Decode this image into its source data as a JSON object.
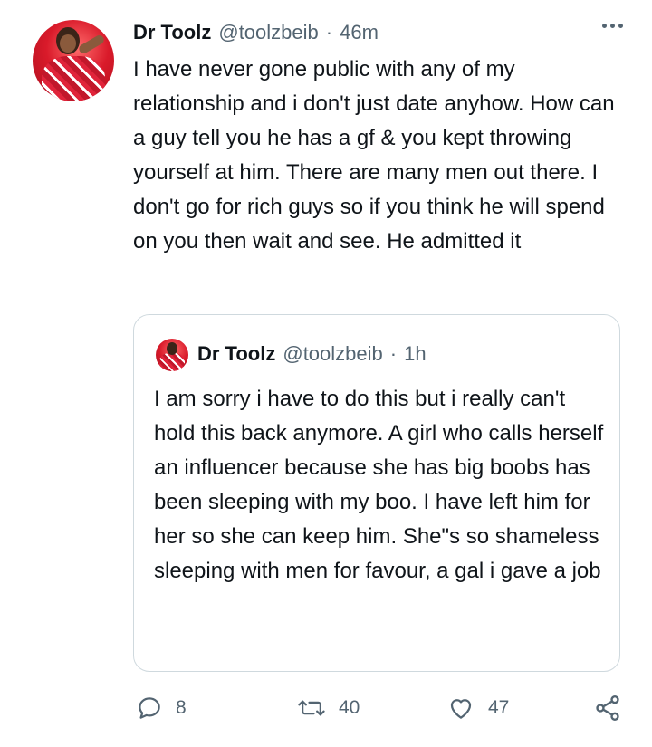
{
  "tweet": {
    "author_name": "Dr Toolz",
    "author_handle": "@toolzbeib",
    "separator": "·",
    "time": "46m",
    "text": "I have never gone public with any of my relationship and i don't just date anyhow. How can a guy tell you he has a gf & you kept throwing yourself at him. There are many men out there. I don't go for rich guys so if you think he will spend on you then wait and see. He admitted it"
  },
  "quoted_tweet": {
    "author_name": "Dr Toolz",
    "author_handle": "@toolzbeib",
    "separator": "·",
    "time": "1h",
    "text": "I am sorry i have to do this but i really can't hold this back anymore. A girl who calls herself an influencer because she has big boobs has been sleeping with my boo. I have left him for her so she can keep him. She\"s so shameless sleeping with men for favour, a gal i gave a job"
  },
  "actions": {
    "reply_count": "8",
    "retweet_count": "40",
    "like_count": "47",
    "icons": [
      "reply-icon",
      "retweet-icon",
      "like-icon",
      "share-icon"
    ]
  },
  "colors": {
    "text": "#0f1419",
    "secondary": "#536471",
    "border": "#cfd9de"
  }
}
